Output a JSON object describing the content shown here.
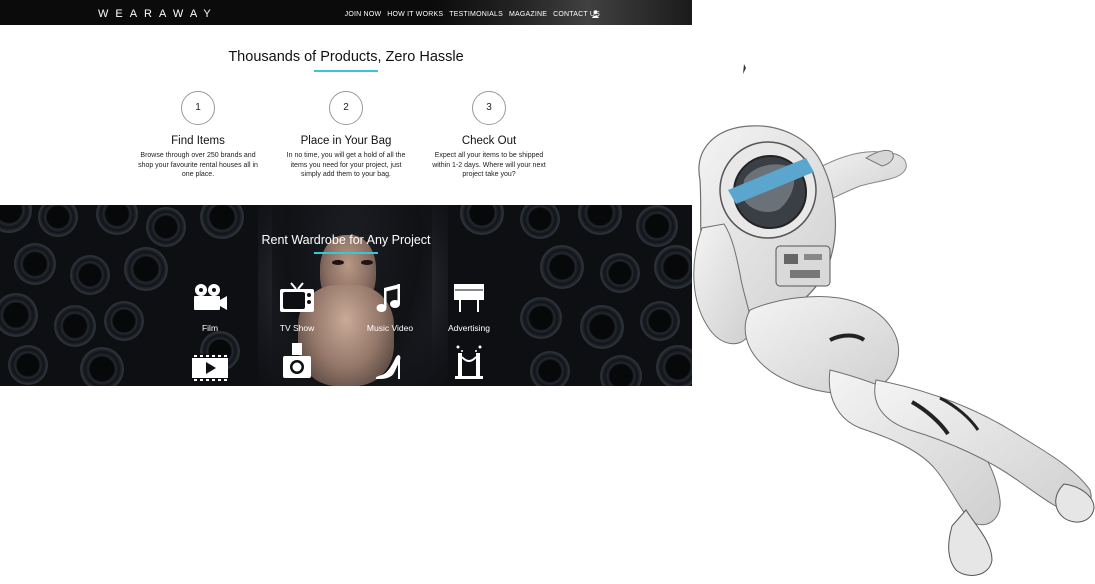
{
  "header": {
    "logo": "WEARAWAY",
    "nav": [
      "JOIN NOW",
      "HOW IT WORKS",
      "TESTIMONIALS",
      "MAGAZINE",
      "CONTACT US"
    ],
    "user_icon": "user-icon"
  },
  "how_it_works": {
    "title": "Thousands of Products, Zero Hassle",
    "accent_color": "#3bc6d4",
    "steps": [
      {
        "number": "1",
        "title": "Find Items",
        "desc": "Browse through over 250 brands and shop your favourite rental houses all in one place."
      },
      {
        "number": "2",
        "title": "Place in Your Bag",
        "desc": "In no time, you will get a hold of all the items you need for your project, just simply add them to your bag."
      },
      {
        "number": "3",
        "title": "Check Out",
        "desc": "Expect all your items to be shipped within 1-2 days. Where will your next project take you?"
      }
    ]
  },
  "wardrobe": {
    "title": "Rent Wardrobe for Any Project",
    "categories": [
      {
        "label": "Film",
        "icon": "film-camera-icon"
      },
      {
        "label": "TV Show",
        "icon": "tv-icon"
      },
      {
        "label": "Music Video",
        "icon": "music-note-icon"
      },
      {
        "label": "Advertising",
        "icon": "billboard-icon"
      },
      {
        "label": "",
        "icon": "video-play-icon"
      },
      {
        "label": "",
        "icon": "photo-camera-icon"
      },
      {
        "label": "",
        "icon": "high-heel-icon"
      },
      {
        "label": "",
        "icon": "red-carpet-icon"
      }
    ]
  },
  "decor": {
    "astronaut": "astronaut-image"
  }
}
